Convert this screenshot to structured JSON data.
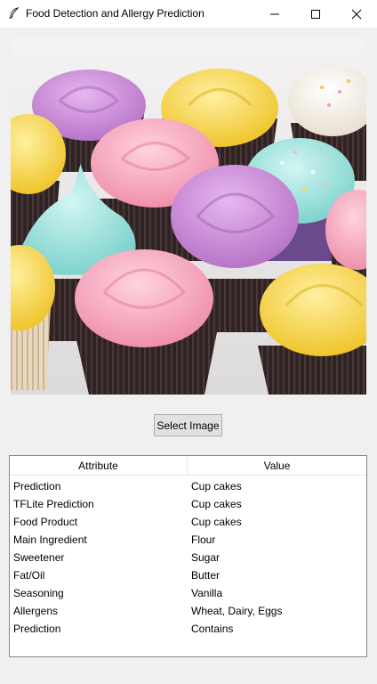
{
  "window": {
    "title": "Food Detection and Allergy Prediction"
  },
  "button": {
    "select_label": "Select Image"
  },
  "table": {
    "headers": [
      "Attribute",
      "Value"
    ],
    "rows": [
      [
        "Prediction",
        "Cup cakes"
      ],
      [
        "TFLite Prediction",
        "Cup cakes"
      ],
      [
        "Food Product",
        "Cup cakes"
      ],
      [
        "Main Ingredient",
        "Flour"
      ],
      [
        "Sweetener",
        "Sugar"
      ],
      [
        "Fat/Oil",
        "Butter"
      ],
      [
        "Seasoning",
        "Vanilla"
      ],
      [
        "Allergens",
        "Wheat, Dairy, Eggs"
      ],
      [
        "Prediction",
        "Contains"
      ]
    ]
  },
  "image": {
    "subject": "cupcakes with pastel frosting"
  },
  "colors": {
    "background": "#f0f0f0",
    "frosting_pink": "#f7a8bf",
    "frosting_purple": "#c88bd6",
    "frosting_yellow": "#f6d64a",
    "frosting_mint": "#9fe0dc",
    "frosting_white": "#f7f3ea",
    "liner_dark": "#3a2a2a"
  }
}
